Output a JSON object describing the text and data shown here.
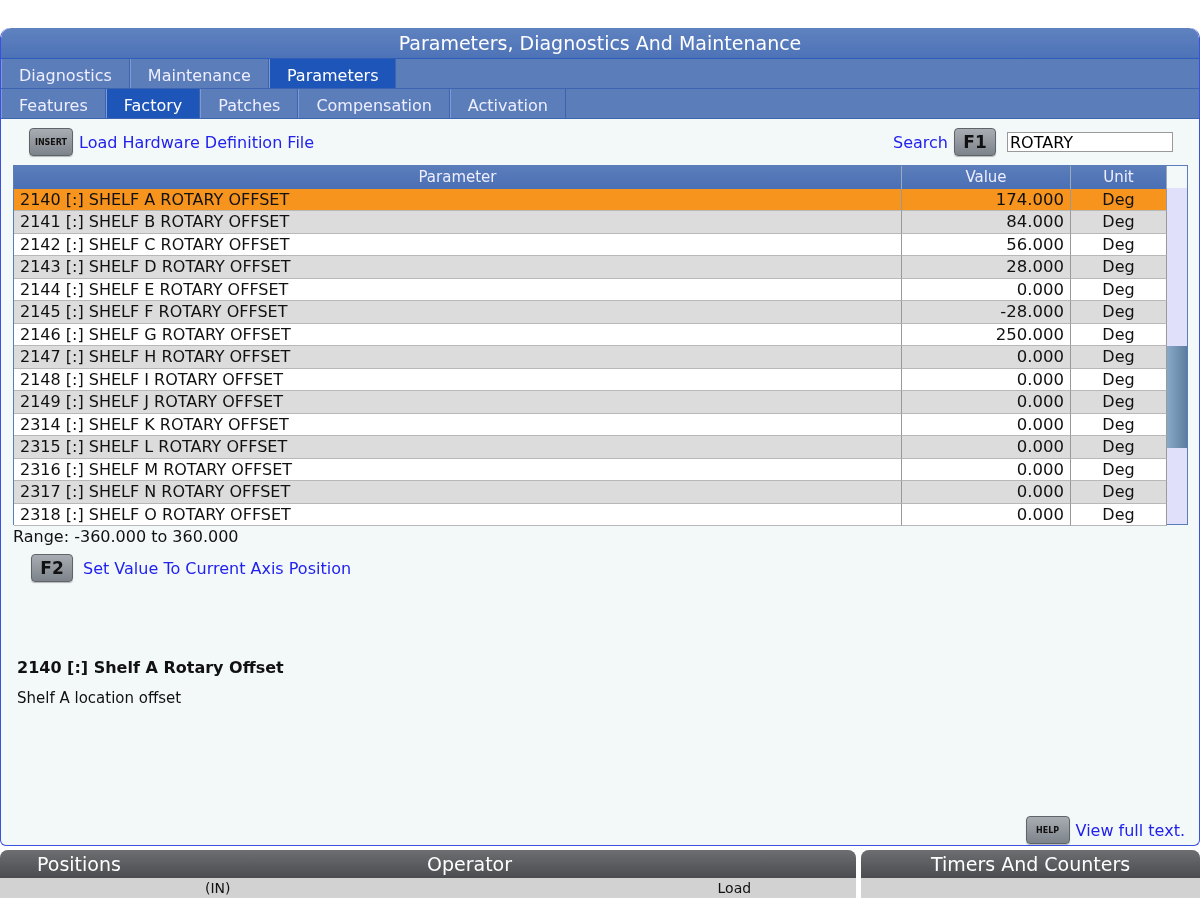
{
  "window": {
    "title": "Parameters, Diagnostics And Maintenance"
  },
  "tabs": [
    {
      "label": "Diagnostics",
      "selected": false
    },
    {
      "label": "Maintenance",
      "selected": false
    },
    {
      "label": "Parameters",
      "selected": true
    }
  ],
  "subtabs": [
    {
      "label": "Features",
      "selected": false
    },
    {
      "label": "Factory",
      "selected": true
    },
    {
      "label": "Patches",
      "selected": false
    },
    {
      "label": "Compensation",
      "selected": false
    },
    {
      "label": "Activation",
      "selected": false
    }
  ],
  "toolbar": {
    "key": "INSERT",
    "action": "Load Hardware Definition File",
    "search_label": "Search",
    "search_key": "F1",
    "search_value": "ROTARY"
  },
  "table": {
    "columns": [
      "Parameter",
      "Value",
      "Unit"
    ],
    "rows": [
      {
        "parameter": "2140 [:] SHELF A ROTARY OFFSET",
        "value": "174.000",
        "unit": "Deg",
        "selected": true
      },
      {
        "parameter": "2141 [:] SHELF B ROTARY OFFSET",
        "value": "84.000",
        "unit": "Deg",
        "selected": false
      },
      {
        "parameter": "2142 [:] SHELF C ROTARY OFFSET",
        "value": "56.000",
        "unit": "Deg",
        "selected": false
      },
      {
        "parameter": "2143 [:] SHELF D ROTARY OFFSET",
        "value": "28.000",
        "unit": "Deg",
        "selected": false
      },
      {
        "parameter": "2144 [:] SHELF E ROTARY OFFSET",
        "value": "0.000",
        "unit": "Deg",
        "selected": false
      },
      {
        "parameter": "2145 [:] SHELF F ROTARY OFFSET",
        "value": "-28.000",
        "unit": "Deg",
        "selected": false
      },
      {
        "parameter": "2146 [:] SHELF G ROTARY OFFSET",
        "value": "250.000",
        "unit": "Deg",
        "selected": false
      },
      {
        "parameter": "2147 [:] SHELF H ROTARY OFFSET",
        "value": "0.000",
        "unit": "Deg",
        "selected": false
      },
      {
        "parameter": "2148 [:] SHELF I ROTARY OFFSET",
        "value": "0.000",
        "unit": "Deg",
        "selected": false
      },
      {
        "parameter": "2149 [:] SHELF J ROTARY OFFSET",
        "value": "0.000",
        "unit": "Deg",
        "selected": false
      },
      {
        "parameter": "2314 [:] SHELF K ROTARY OFFSET",
        "value": "0.000",
        "unit": "Deg",
        "selected": false
      },
      {
        "parameter": "2315 [:] SHELF L ROTARY OFFSET",
        "value": "0.000",
        "unit": "Deg",
        "selected": false
      },
      {
        "parameter": "2316 [:] SHELF M ROTARY OFFSET",
        "value": "0.000",
        "unit": "Deg",
        "selected": false
      },
      {
        "parameter": "2317 [:] SHELF N ROTARY OFFSET",
        "value": "0.000",
        "unit": "Deg",
        "selected": false
      },
      {
        "parameter": "2318 [:] SHELF O ROTARY OFFSET",
        "value": "0.000",
        "unit": "Deg",
        "selected": false
      }
    ]
  },
  "range": "Range: -360.000 to 360.000",
  "axis_action": {
    "key": "F2",
    "label": "Set Value To Current Axis Position"
  },
  "detail": {
    "title": "2140 [:] Shelf A Rotary Offset",
    "description": "Shelf A location offset"
  },
  "help": {
    "key": "HELP",
    "label": "View full text."
  },
  "bottom_panels": [
    {
      "title": "Positions",
      "subtitle": "Operator",
      "cells": [
        "(IN)",
        "Load"
      ]
    },
    {
      "title": "Timers And Counters"
    }
  ]
}
